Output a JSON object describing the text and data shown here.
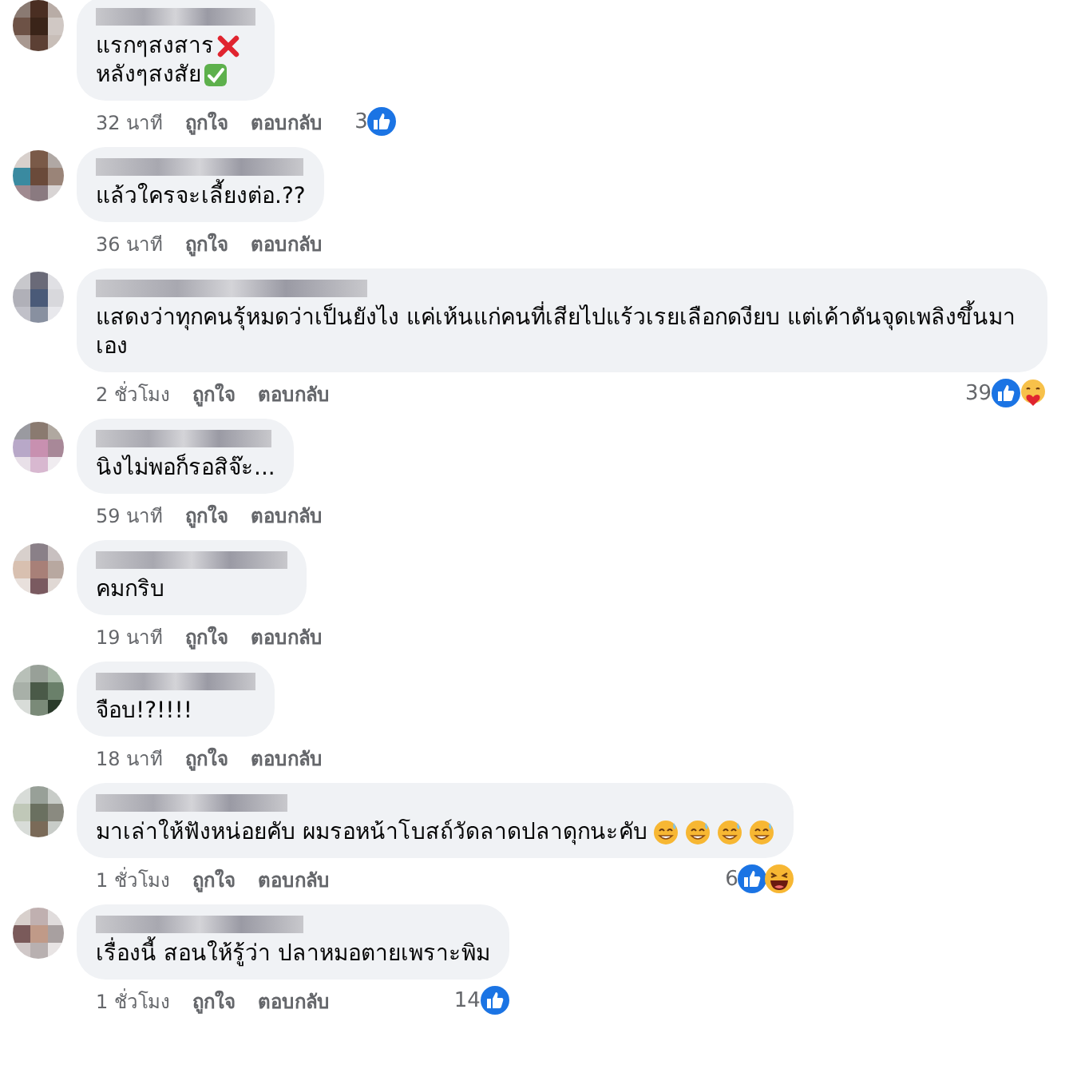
{
  "comments": [
    {
      "lines": [
        {
          "text": "แรกๆสงสาร",
          "emoji": [
            {
              "kind": "cross"
            }
          ]
        },
        {
          "text": "หลังๆสงสัย",
          "emoji": [
            {
              "kind": "check"
            }
          ]
        }
      ],
      "time": "32 นาที",
      "like": "ถูกใจ",
      "reply": "ตอบกลับ",
      "reactions": {
        "count": "3",
        "icons": [
          {
            "kind": "like"
          }
        ]
      }
    },
    {
      "lines": [
        {
          "text": "แล้วใครจะเลี้ยงต่อ.??"
        }
      ],
      "time": "36 นาที",
      "like": "ถูกใจ",
      "reply": "ตอบกลับ"
    },
    {
      "lines": [
        {
          "text": "แสดงว่าทุกคนรุ้หมดว่าเป็นยังไง แค่เห้นแก่คนที่เสียไปแร้วเรยเลือกดงียบ แต่เค้าดันจุดเพลิงขึ้นมาเอง"
        }
      ],
      "time": "2 ชั่วโมง",
      "like": "ถูกใจ",
      "reply": "ตอบกลับ",
      "reactions": {
        "count": "39",
        "icons": [
          {
            "kind": "like"
          },
          {
            "kind": "care"
          }
        ]
      }
    },
    {
      "lines": [
        {
          "text": "นิงไม่พอก็รอสิจ๊ะ..."
        }
      ],
      "time": "59 นาที",
      "like": "ถูกใจ",
      "reply": "ตอบกลับ"
    },
    {
      "lines": [
        {
          "text": "คมกริบ"
        }
      ],
      "time": "19 นาที",
      "like": "ถูกใจ",
      "reply": "ตอบกลับ"
    },
    {
      "lines": [
        {
          "text": "จือบ!?!!!!"
        }
      ],
      "time": "18 นาที",
      "like": "ถูกใจ",
      "reply": "ตอบกลับ"
    },
    {
      "lines": [
        {
          "text": "มาเล่าให้ฟังหน่อยคับ ผมรอหน้าโบสถ์วัดลาดปลาดุกนะคับ",
          "emoji": [
            {
              "kind": "sweat"
            },
            {
              "kind": "sweat"
            },
            {
              "kind": "sweat"
            },
            {
              "kind": "sweat"
            }
          ]
        }
      ],
      "time": "1 ชั่วโมง",
      "like": "ถูกใจ",
      "reply": "ตอบกลับ",
      "reactions": {
        "count": "6",
        "icons": [
          {
            "kind": "like"
          },
          {
            "kind": "haha"
          }
        ]
      }
    },
    {
      "lines": [
        {
          "text": "เรื่องนี้ สอนให้รู้ว่า ปลาหมอตายเพราะพิม"
        }
      ],
      "time": "1 ชั่วโมง",
      "like": "ถูกใจ",
      "reply": "ตอบกลับ",
      "reactions": {
        "count": "14",
        "icons": [
          {
            "kind": "like"
          }
        ]
      }
    }
  ]
}
